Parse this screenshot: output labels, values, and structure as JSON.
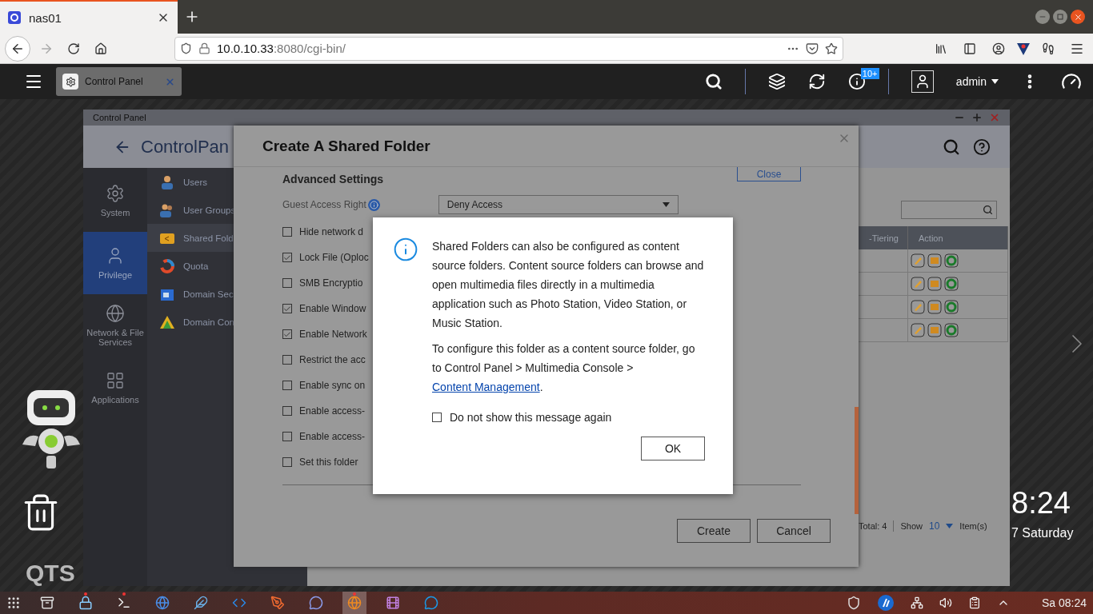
{
  "browser": {
    "tab_title": "nas01",
    "url_host": "10.0.10.33",
    "url_path": ":8080/cgi-bin/"
  },
  "topbar": {
    "app_tab": "Control Panel",
    "badge": "10+",
    "user": "admin"
  },
  "desktop": {
    "logo": "QTS",
    "time": "8:24",
    "date": "7 Saturday"
  },
  "control_panel": {
    "title": "Control Panel",
    "header": "**Control**Pan",
    "categories": [
      {
        "label": "System",
        "selected": false
      },
      {
        "label": "Privilege",
        "selected": true
      },
      {
        "label": "Network & File Services",
        "selected": false
      },
      {
        "label": "Applications",
        "selected": false
      }
    ],
    "menu": [
      {
        "label": "Users",
        "selected": false
      },
      {
        "label": "User Groups",
        "selected": false
      },
      {
        "label": "Shared Fold",
        "selected": true
      },
      {
        "label": "Quota",
        "selected": false
      },
      {
        "label": "Domain Sec",
        "selected": false
      },
      {
        "label": "Domain Con",
        "selected": false
      }
    ],
    "table": {
      "columns": [
        "-Tiering",
        "Action"
      ],
      "rows": [
        {
          "selected": false
        },
        {
          "selected": false
        },
        {
          "selected": false
        },
        {
          "selected": false
        }
      ]
    },
    "footer": {
      "total": "Total: 4",
      "show": "Show",
      "page_size": "10",
      "items": "Item(s)"
    }
  },
  "create_dialog": {
    "title": "Create A Shared Folder",
    "close_button": "Close",
    "section": "Advanced Settings",
    "guest_label": "Guest Access Right",
    "guest_value": "Deny Access",
    "options": [
      {
        "label": "Hide network d",
        "checked": false
      },
      {
        "label": "Lock File (Oploc",
        "checked": true
      },
      {
        "label": "SMB Encryptio",
        "checked": false
      },
      {
        "label": "Enable Window",
        "checked": true
      },
      {
        "label": "Enable Network",
        "checked": true
      },
      {
        "label": "Restrict the acc",
        "checked": false
      },
      {
        "label": "Enable sync on",
        "checked": false
      },
      {
        "label": "Enable access-",
        "checked": false
      },
      {
        "label": "Enable access-",
        "checked": false
      },
      {
        "label": "Set this folder",
        "checked": false
      }
    ],
    "buttons": [
      "Create",
      "Cancel"
    ]
  },
  "info_dialog": {
    "text": "Shared Folders can also be configured as content source folders. Content source folders can browse and open multimedia files directly in a multimedia application such as Photo Station, Video Station, or Music Station.",
    "config_text": "To configure this folder as a content source folder, go to Control Panel > Multimedia Console >",
    "link": "Content Management",
    "end": ".",
    "dont_show": {
      "label": "Do not show this message again",
      "checked": false
    },
    "ok": "OK"
  },
  "taskbar": {
    "apps": [
      {
        "running": false,
        "selected": false
      },
      {
        "running": true,
        "selected": false
      },
      {
        "running": true,
        "selected": false
      },
      {
        "running": false,
        "selected": false
      },
      {
        "running": false,
        "selected": false
      },
      {
        "running": false,
        "selected": false
      },
      {
        "running": false,
        "selected": false
      },
      {
        "running": false,
        "selected": false
      },
      {
        "running": true,
        "selected": true
      },
      {
        "running": false,
        "selected": false
      },
      {
        "running": false,
        "selected": false
      }
    ],
    "clock": "Sa 08:24"
  }
}
